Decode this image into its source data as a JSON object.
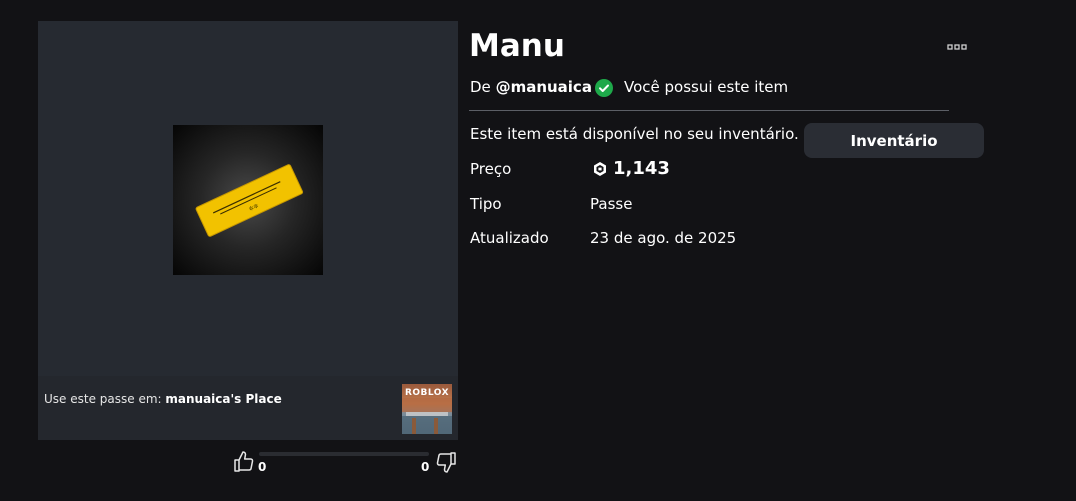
{
  "item": {
    "title": "Manu",
    "creator_prefix": "De",
    "creator_name": "@manuaica",
    "owned_text": "Você possui este item",
    "available_text": "Este item está disponível no seu inventário.",
    "inventory_button": "Inventário"
  },
  "details": {
    "price_label": "Preço",
    "price_value": "1,143",
    "type_label": "Tipo",
    "type_value": "Passe",
    "updated_label": "Atualizado",
    "updated_value": "23 de ago. de 2025"
  },
  "media": {
    "use_prefix": "Use este passe em:",
    "place_name": "manuaica's Place",
    "place_logo": "ROBLOX"
  },
  "votes": {
    "up": "0",
    "down": "0"
  },
  "colors": {
    "background": "#121215",
    "panel": "#262a31",
    "owned_check": "#1ea94a",
    "pass_yellow": "#f2c200"
  },
  "icons": [
    "more-icon",
    "check-icon",
    "robux-icon",
    "thumb-up-icon",
    "thumb-down-icon"
  ]
}
